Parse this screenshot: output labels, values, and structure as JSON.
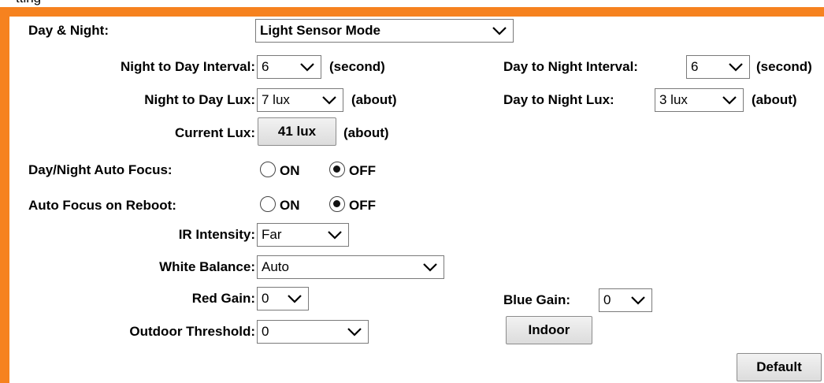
{
  "header_cut_text": "tting",
  "colors": {
    "accent": "#f6821f"
  },
  "icons": {
    "dropdown": "chevron-down-icon"
  },
  "day_night": {
    "label": "Day & Night:",
    "value": "Light Sensor Mode"
  },
  "night_to_day_interval": {
    "label": "Night to Day Interval:",
    "value": "6",
    "unit": "(second)"
  },
  "day_to_night_interval": {
    "label": "Day to Night Interval:",
    "value": "6",
    "unit": "(second)"
  },
  "night_to_day_lux": {
    "label": "Night to Day Lux:",
    "value": "7 lux",
    "unit": "(about)"
  },
  "day_to_night_lux": {
    "label": "Day to Night Lux:",
    "value": "3 lux",
    "unit": "(about)"
  },
  "current_lux": {
    "label": "Current Lux:",
    "value": "41 lux",
    "unit": "(about)"
  },
  "day_night_auto_focus": {
    "label": "Day/Night Auto Focus:",
    "on_label": "ON",
    "off_label": "OFF",
    "selected": "OFF"
  },
  "auto_focus_on_reboot": {
    "label": "Auto Focus on Reboot:",
    "on_label": "ON",
    "off_label": "OFF",
    "selected": "OFF"
  },
  "ir_intensity": {
    "label": "IR Intensity:",
    "value": "Far"
  },
  "white_balance": {
    "label": "White Balance:",
    "value": "Auto"
  },
  "red_gain": {
    "label": "Red Gain:",
    "value": "0"
  },
  "blue_gain": {
    "label": "Blue Gain:",
    "value": "0"
  },
  "outdoor_threshold": {
    "label": "Outdoor Threshold:",
    "value": "0"
  },
  "buttons": {
    "indoor": "Indoor",
    "default": "Default"
  }
}
